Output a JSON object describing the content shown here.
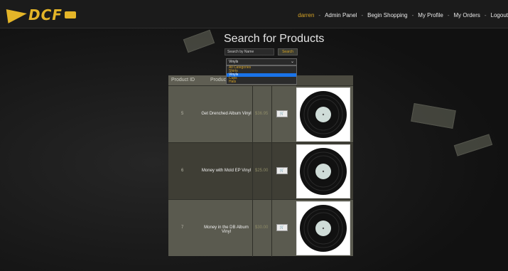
{
  "nav": {
    "logo_text": "DCF",
    "user": "darren",
    "links": [
      "Admin Panel",
      "Begin Shopping",
      "My Profile",
      "My Orders",
      "Logout"
    ],
    "separator": "-"
  },
  "search": {
    "title": "Search for Products",
    "placeholder": "Search by Name",
    "button_label": "Search",
    "category_selected": "Vinyls",
    "category_options": [
      "All Categories",
      "Shirts",
      "Vinyls",
      "Cups",
      "Hats"
    ],
    "highlighted_option": "Vinyls"
  },
  "table": {
    "headers": [
      "Product ID",
      "Product"
    ],
    "rows": [
      {
        "id": "5",
        "name": "Get Drenched Album Vinyl",
        "price": "$36.95",
        "button": "🛒"
      },
      {
        "id": "6",
        "name": "Money with Mold EP Vinyl",
        "price": "$25.00",
        "button": "🛒"
      },
      {
        "id": "7",
        "name": "Money in the DB Album Vinyl",
        "price": "$30.00",
        "button": "🛒"
      }
    ]
  },
  "colors": {
    "accent": "#e4b528",
    "dropdown_highlight": "#1a73e8",
    "table_bg": "#4b4a40"
  }
}
